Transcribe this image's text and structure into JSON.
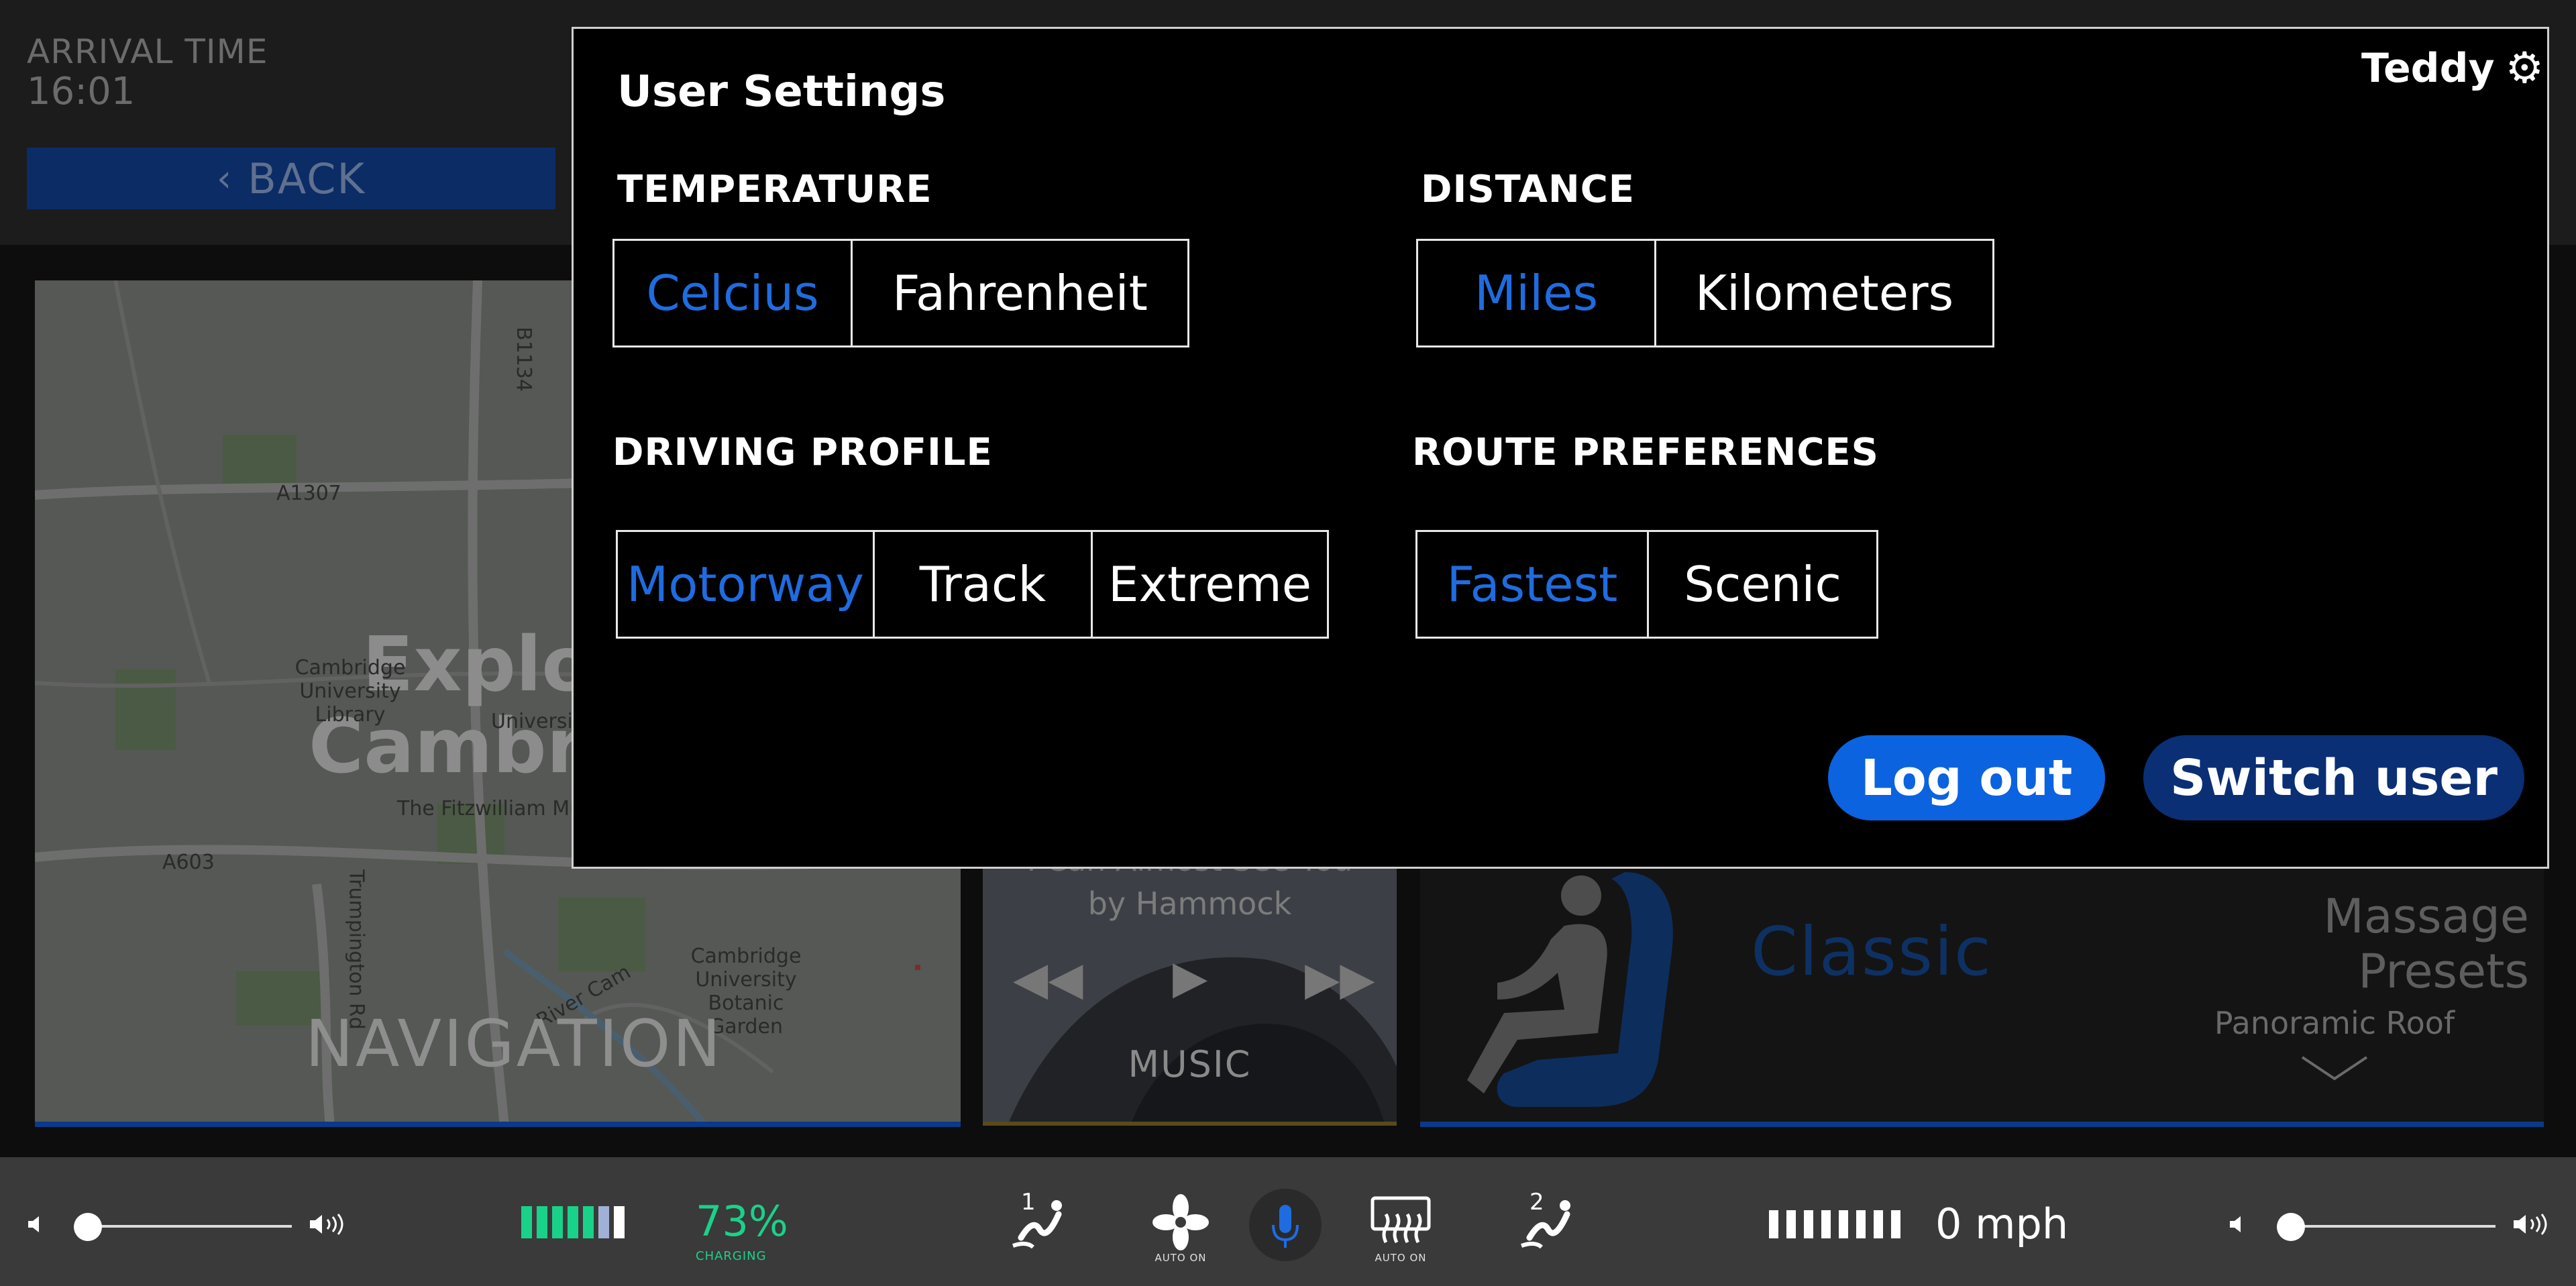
{
  "header": {
    "arrival_label": "ARRIVAL TIME",
    "arrival_time": "16:01",
    "back_label": "BACK"
  },
  "map": {
    "heading_line1": "Explor",
    "heading_line2": "Cambri",
    "places": [
      "Cambridge University Library",
      "University",
      "The Fitzwilliam Museum",
      "Cambridge University Botanic Garden"
    ],
    "roads": [
      "A1307",
      "B1134",
      "A603",
      "Trumpington Rd",
      "River Cam"
    ],
    "tile_label": "NAVIGATION"
  },
  "music": {
    "track": "I Can Almost See You",
    "artist": "by Hammock",
    "tile_label": "MUSIC"
  },
  "seat": {
    "mode": "Classic",
    "massage_label": "Massage Presets",
    "roof_label": "Panoramic Roof"
  },
  "modal": {
    "title": "User Settings",
    "user_name": "Teddy",
    "temperature": {
      "label": "TEMPERATURE",
      "options": [
        "Celcius",
        "Fahrenheit"
      ],
      "selected": 0
    },
    "distance": {
      "label": "DISTANCE",
      "options": [
        "Miles",
        "Kilometers"
      ],
      "selected": 0
    },
    "driving_profile": {
      "label": "DRIVING PROFILE",
      "options": [
        "Motorway",
        "Track",
        "Extreme"
      ],
      "selected": 0
    },
    "route": {
      "label": "ROUTE PREFERENCES",
      "options": [
        "Fastest",
        "Scenic"
      ],
      "selected": 0
    },
    "logout_label": "Log out",
    "switch_label": "Switch user"
  },
  "bottom_bar": {
    "battery_percent": "73%",
    "battery_status": "CHARGING",
    "battery_level": 0.73,
    "speed": "0 mph",
    "fan_status": "AUTO ON",
    "defrost_status": "AUTO ON",
    "seat1_label": "1",
    "seat2_label": "2",
    "left_volume": 0.0,
    "right_volume": 0.0
  },
  "colors": {
    "accent_blue": "#1f6ce0",
    "logout_blue": "#0b63df",
    "switch_navy": "#0a2f74",
    "battery_green": "#19d28a"
  }
}
